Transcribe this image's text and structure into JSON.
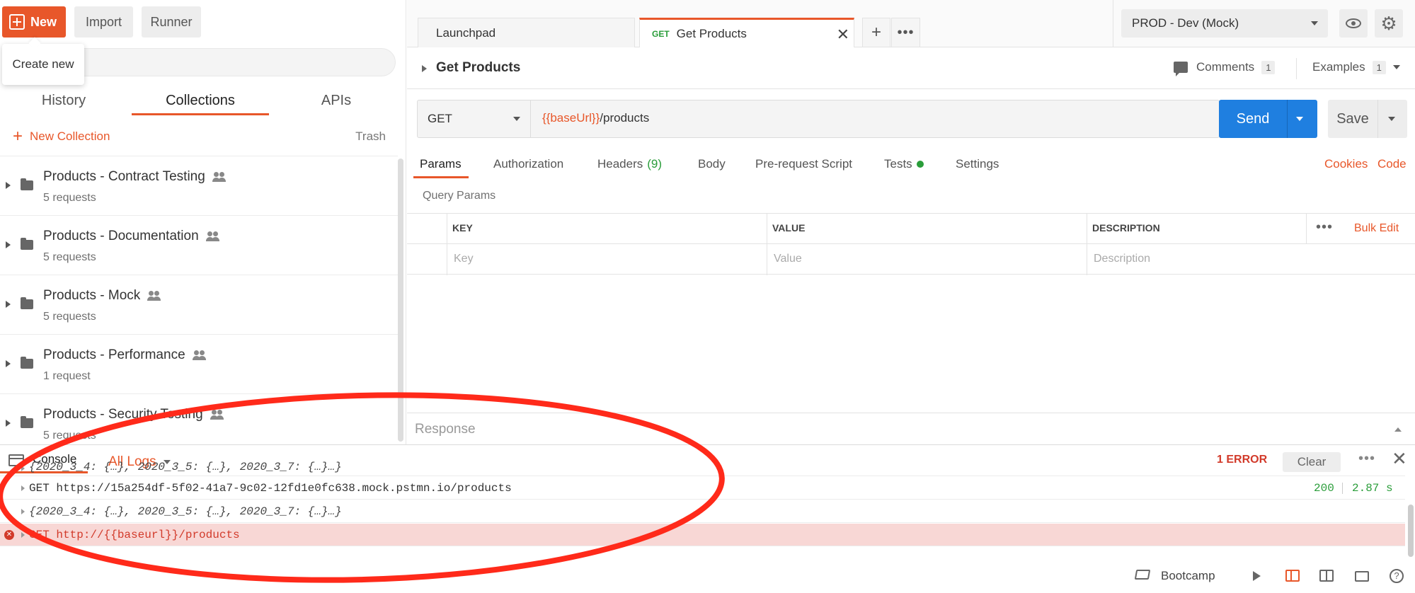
{
  "toolbar": {
    "new_label": "New",
    "import_label": "Import",
    "runner_label": "Runner",
    "tooltip": "Create new"
  },
  "sidebar": {
    "tabs": [
      "History",
      "Collections",
      "APIs"
    ],
    "active_tab": "Collections",
    "new_collection_label": "New Collection",
    "trash_label": "Trash",
    "collections": [
      {
        "name": "Products - Contract Testing",
        "count": "5 requests"
      },
      {
        "name": "Products - Documentation",
        "count": "5 requests"
      },
      {
        "name": "Products - Mock",
        "count": "5 requests"
      },
      {
        "name": "Products - Performance",
        "count": "1 request"
      },
      {
        "name": "Products - Security Testing",
        "count": "5 requests"
      }
    ]
  },
  "tabs": {
    "launchpad": "Launchpad",
    "active_method": "GET",
    "active_name": "Get Products"
  },
  "environment": {
    "selected": "PROD - Dev (Mock)"
  },
  "request": {
    "title": "Get Products",
    "comments_label": "Comments",
    "comments_count": "1",
    "examples_label": "Examples",
    "examples_count": "1",
    "method": "GET",
    "url_var": "{{baseUrl}}",
    "url_path": "/products",
    "send_label": "Send",
    "save_label": "Save",
    "tabs": {
      "params": "Params",
      "authorization": "Authorization",
      "headers": "Headers",
      "headers_count": "(9)",
      "body": "Body",
      "prerequest": "Pre-request Script",
      "tests": "Tests",
      "settings": "Settings"
    },
    "cookies_label": "Cookies",
    "code_label": "Code",
    "query_params_title": "Query Params",
    "table": {
      "headers": [
        "KEY",
        "VALUE",
        "DESCRIPTION"
      ],
      "placeholders": [
        "Key",
        "Value",
        "Description"
      ],
      "bulk_edit": "Bulk Edit"
    },
    "response_label": "Response"
  },
  "console": {
    "title": "Console",
    "filter": "All Logs",
    "error_count": "1 ERROR",
    "clear_label": "Clear",
    "logs": [
      {
        "text": "{2020_3_4: {…}, 2020_3_5: {…}, 2020_3_7: {…}…}",
        "kind": "object"
      },
      {
        "text": "GET https://15a254df-5f02-41a7-9c02-12fd1e0fc638.mock.pstmn.io/products",
        "kind": "request",
        "status": "200",
        "time": "2.87 s"
      },
      {
        "text": "{2020_3_4: {…}, 2020_3_5: {…}, 2020_3_7: {…}…}",
        "kind": "object"
      },
      {
        "text": "GET http://{{baseurl}}/products",
        "kind": "error"
      }
    ]
  },
  "statusbar": {
    "bootcamp_label": "Bootcamp"
  },
  "colors": {
    "accent": "#e8572a",
    "send": "#1f7fe0",
    "success": "#2a9d3a",
    "error": "#d23a2a",
    "annotation": "#ff2a1a"
  }
}
